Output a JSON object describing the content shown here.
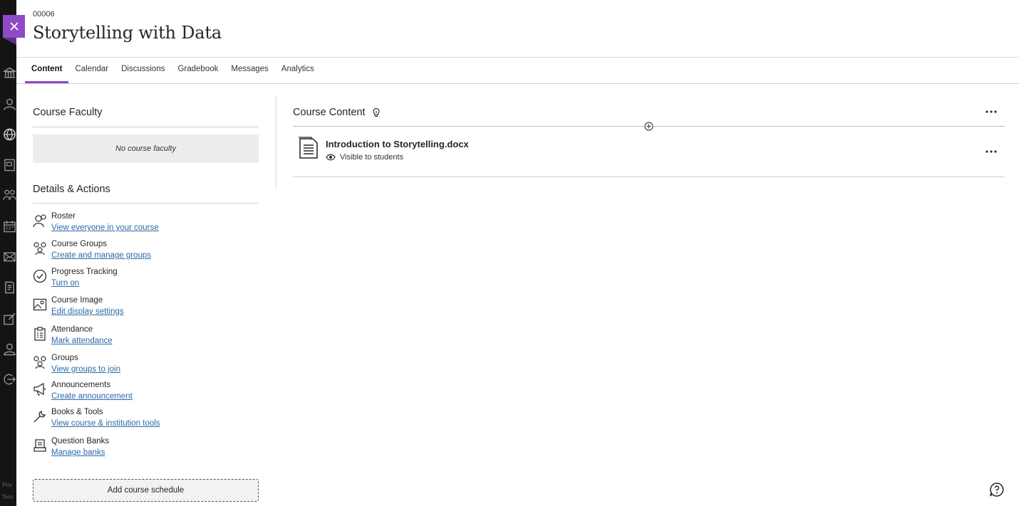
{
  "header": {
    "course_id": "00006",
    "course_title": "Storytelling with Data"
  },
  "tabs": [
    {
      "label": "Content",
      "active": true
    },
    {
      "label": "Calendar"
    },
    {
      "label": "Discussions"
    },
    {
      "label": "Gradebook"
    },
    {
      "label": "Messages"
    },
    {
      "label": "Analytics"
    }
  ],
  "rail": {
    "icons": [
      "institution-icon",
      "profile-icon",
      "globe-icon",
      "courses-icon",
      "organizations-icon",
      "calendar-icon",
      "messages-icon",
      "grades-icon",
      "tools-icon",
      "user-icon",
      "sign-out-icon"
    ],
    "footer": [
      "Priv",
      "Tern"
    ]
  },
  "faculty": {
    "heading": "Course Faculty",
    "empty_text": "No course faculty"
  },
  "details": {
    "heading": "Details & Actions",
    "items": [
      {
        "title": "Roster",
        "link": "View everyone in your course",
        "icon": "roster-icon"
      },
      {
        "title": "Course Groups",
        "link": "Create and manage groups",
        "icon": "groups-icon"
      },
      {
        "title": "Progress Tracking",
        "link": "Turn on",
        "icon": "checkmark-circle-icon"
      },
      {
        "title": "Course Image",
        "link": "Edit display settings",
        "icon": "image-icon"
      },
      {
        "title": "Attendance",
        "link": "Mark attendance",
        "icon": "clipboard-icon"
      },
      {
        "title": "Groups",
        "link": "View groups to join",
        "icon": "groups-icon"
      },
      {
        "title": "Announcements",
        "link": "Create announcement",
        "icon": "megaphone-icon"
      },
      {
        "title": "Books & Tools",
        "link": "View course & institution tools",
        "icon": "wrench-icon"
      },
      {
        "title": "Question Banks",
        "link": "Manage banks",
        "icon": "question-bank-icon"
      }
    ],
    "schedule_button": "Add course schedule"
  },
  "content": {
    "heading": "Course Content",
    "items": [
      {
        "name": "Introduction to Storytelling.docx",
        "visibility": "Visible to students",
        "icon": "document-icon"
      }
    ]
  },
  "colors": {
    "accent": "#8e4bc6",
    "link": "#2c6aa3",
    "rail": "#141414"
  }
}
